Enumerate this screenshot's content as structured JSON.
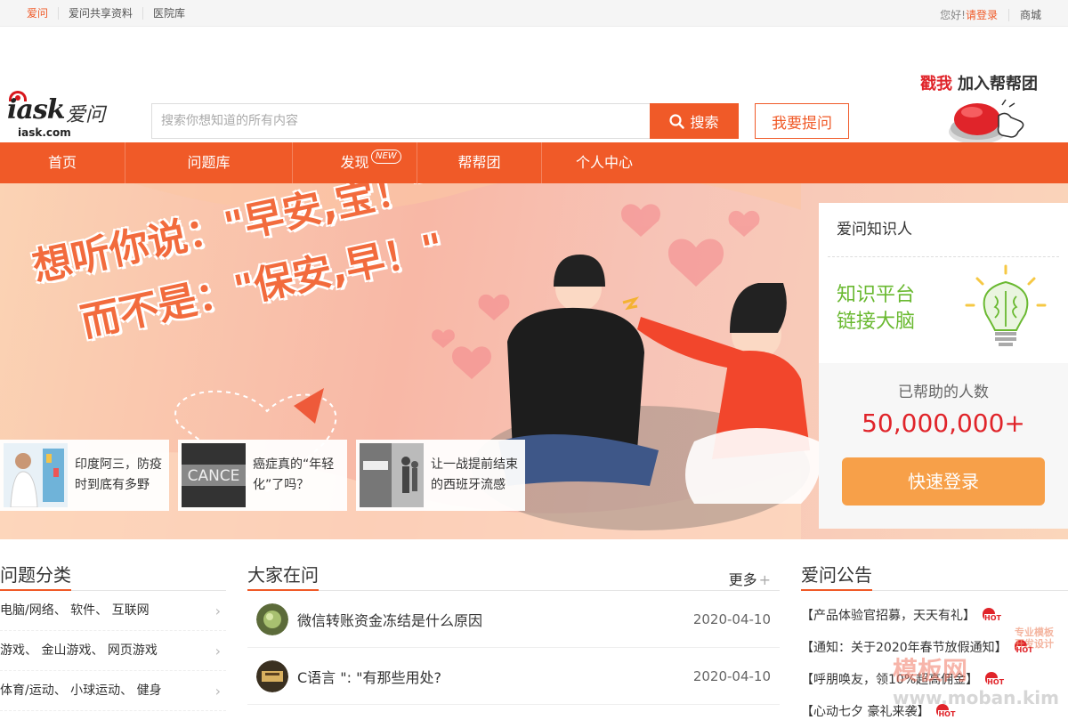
{
  "topbar": {
    "links": [
      "爱问",
      "爱问共享资料",
      "医院库"
    ],
    "greeting": "您好!",
    "login": "请登录",
    "shop": "商城"
  },
  "header": {
    "logo_text": "iask",
    "logo_cn": "爱问",
    "logo_domain": "iask.com",
    "search_placeholder": "搜索你想知道的所有内容",
    "search_button": "搜索",
    "ask_button": "我要提问",
    "poke_highlight": "戳我",
    "poke_text": "加入帮帮团"
  },
  "nav": {
    "items": [
      "首页",
      "问题库",
      "发现",
      "帮帮团",
      "个人中心"
    ],
    "new_badge": "NEW"
  },
  "banner": {
    "line1": "想听你说：\"早安,宝！\"",
    "line2": "而不是：\"保安,早！\"",
    "news": [
      {
        "text": "印度阿三，防疫时到底有多野"
      },
      {
        "text": "癌症真的“年轻化”了吗？"
      },
      {
        "text": "让一战提前结束的西班牙流感"
      }
    ]
  },
  "side": {
    "title": "爱问知识人",
    "slogan1": "知识平台",
    "slogan2": "链接大脑",
    "helped_label": "已帮助的人数",
    "helped_count": "50,000,000+",
    "quick_login": "快速登录"
  },
  "categories": {
    "title": "问题分类",
    "rows": [
      "电脑/网络、 软件、 互联网",
      "游戏、 金山游戏、 网页游戏",
      "体育/运动、 小球运动、 健身"
    ]
  },
  "questions": {
    "title": "大家在问",
    "more": "更多",
    "rows": [
      {
        "q": "微信转账资金冻结是什么原因",
        "date": "2020-04-10"
      },
      {
        "q": "C语言 \": \"有那些用处?",
        "date": "2020-04-10"
      }
    ]
  },
  "notices": {
    "title": "爱问公告",
    "rows": [
      "【产品体验官招募，天天有礼】",
      "【通知：关于2020年春节放假通知】",
      "【呼朋唤友，领10%超高佣金】",
      "【心动七夕 豪礼来袭】"
    ]
  },
  "watermark": {
    "brand": "模板网",
    "line1": "专业模板",
    "line2": "开发设计",
    "url": "www.moban.kim"
  },
  "colors": {
    "brand": "#f05a28",
    "red": "#e0242a",
    "green": "#6ab931",
    "button_orange": "#f7a049"
  }
}
